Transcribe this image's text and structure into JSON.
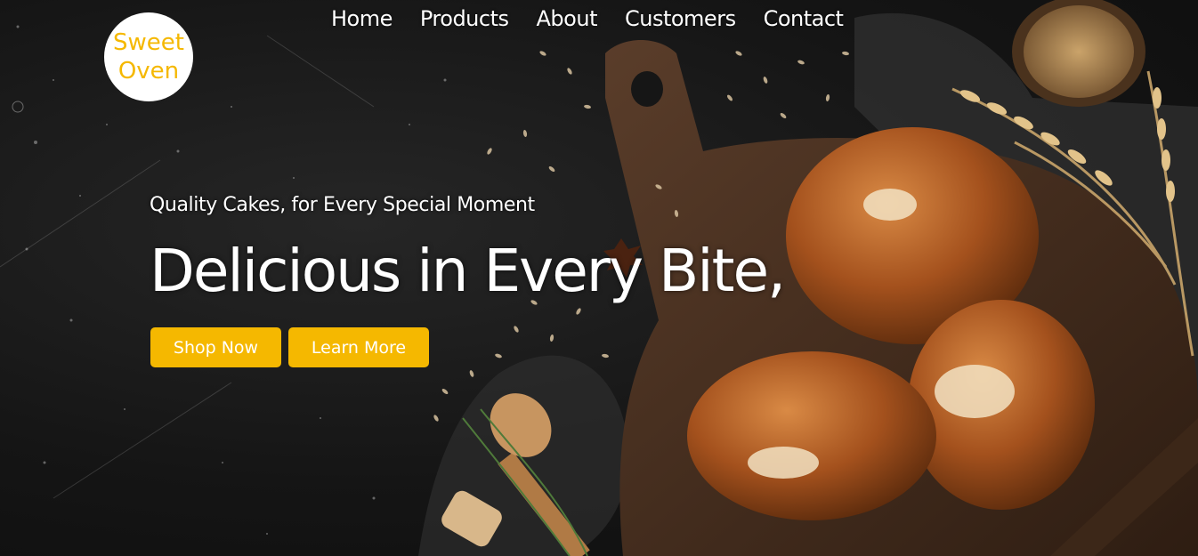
{
  "brand": {
    "line1": "Sweet",
    "line2": "Oven"
  },
  "nav": [
    "Home",
    "Products",
    "About",
    "Customers",
    "Contact"
  ],
  "hero": {
    "subtitle": "Quality Cakes, for Every Special Moment",
    "headline": "Delicious in Every Bite,",
    "primary_button": "Shop Now",
    "secondary_button": "Learn More"
  },
  "colors": {
    "accent": "#f5b800",
    "background": "#141414",
    "text": "#ffffff"
  }
}
